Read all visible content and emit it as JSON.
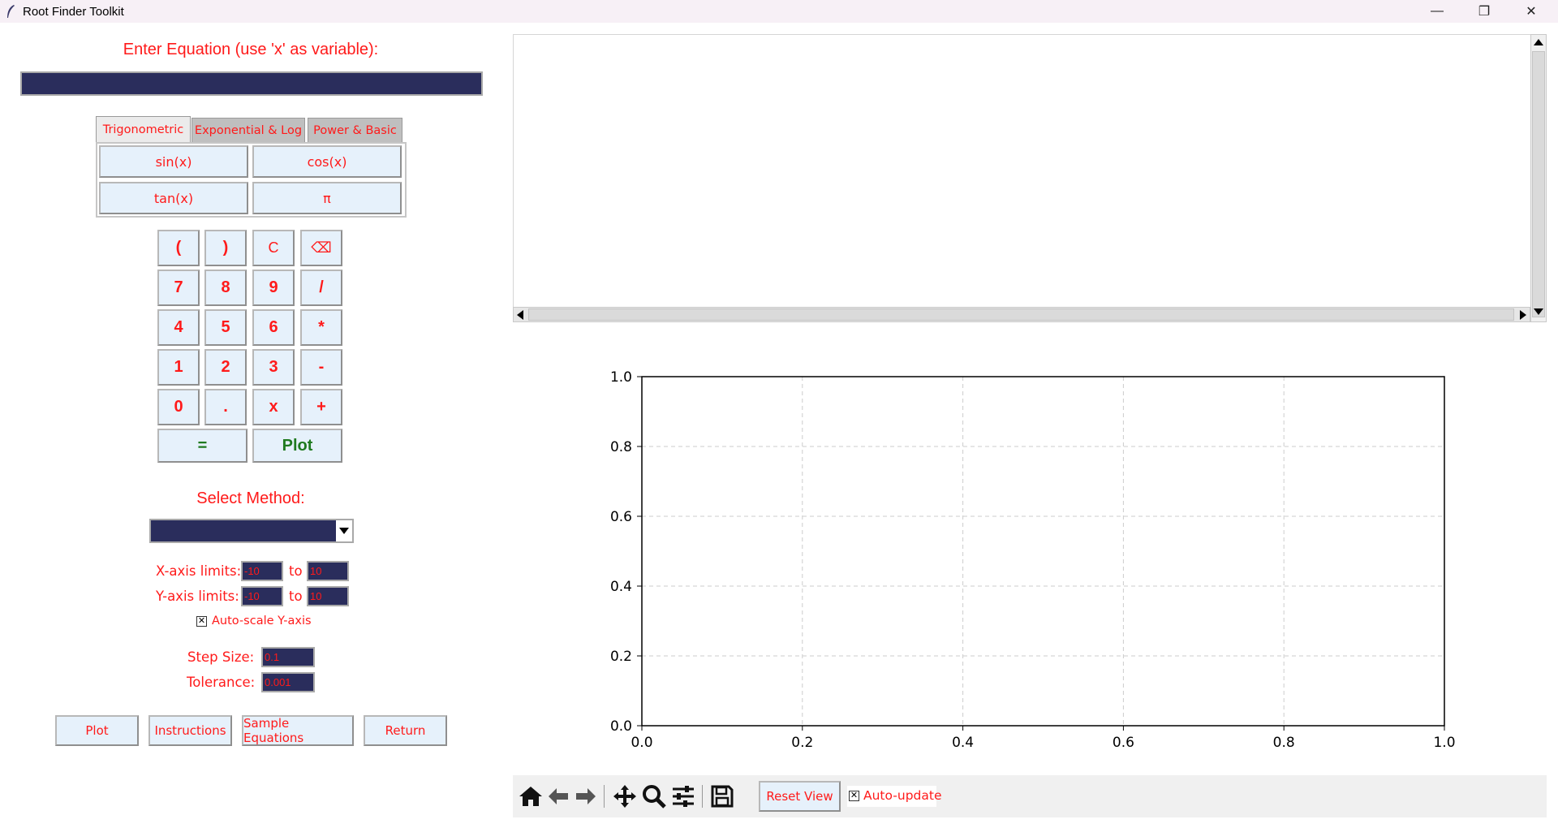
{
  "window": {
    "title": "Root Finder Toolkit",
    "controls": {
      "minimize": "—",
      "restore": "❐",
      "close": "✕"
    }
  },
  "equation": {
    "label": "Enter Equation (use 'x' as variable):",
    "value": ""
  },
  "tabs": [
    {
      "label": "Trigonometric",
      "active": true
    },
    {
      "label": "Exponential & Log",
      "active": false
    },
    {
      "label": "Power & Basic",
      "active": false
    }
  ],
  "functions": [
    "sin(x)",
    "cos(x)",
    "tan(x)",
    "π"
  ],
  "keypad": {
    "rows": [
      [
        "(",
        ")",
        "C",
        "⌫"
      ],
      [
        "7",
        "8",
        "9",
        "/"
      ],
      [
        "4",
        "5",
        "6",
        "*"
      ],
      [
        "1",
        "2",
        "3",
        "-"
      ],
      [
        "0",
        ".",
        "x",
        "+"
      ]
    ],
    "equals": "=",
    "plot": "Plot"
  },
  "method": {
    "label": "Select Method:",
    "value": ""
  },
  "limits": {
    "x_label": "X-axis limits:",
    "y_label": "Y-axis limits:",
    "to": "to",
    "x_min": "-10",
    "x_max": "10",
    "y_min": "-10",
    "y_max": "10"
  },
  "autoscale": {
    "label": "Auto-scale Y-axis",
    "checked": true,
    "mark": "✕"
  },
  "params": {
    "step_label": "Step Size:",
    "step_value": "0.1",
    "tol_label": "Tolerance:",
    "tol_value": "0.001"
  },
  "bottom_buttons": [
    "Plot",
    "Instructions",
    "Sample Equations",
    "Return"
  ],
  "plot_toolbar": {
    "icons": [
      "home-icon",
      "back-arrow-icon",
      "forward-arrow-icon",
      "pan-icon",
      "zoom-icon",
      "configure-icon",
      "save-icon"
    ],
    "reset_label": "Reset View",
    "auto_update_label": "Auto-update",
    "auto_update_checked": true,
    "mark": "✕"
  },
  "colors": {
    "accent_text": "#ff1a1a",
    "input_bg": "#2a2d5c",
    "button_bg": "#e6f1fb",
    "plot_green": "#1f7a1f"
  },
  "chart_data": {
    "type": "line",
    "series": [],
    "xlim": [
      0.0,
      1.0
    ],
    "ylim": [
      0.0,
      1.0
    ],
    "xticks": [
      "0.0",
      "0.2",
      "0.4",
      "0.6",
      "0.8",
      "1.0"
    ],
    "yticks": [
      "0.0",
      "0.2",
      "0.4",
      "0.6",
      "0.8",
      "1.0"
    ],
    "grid": true,
    "title": "",
    "xlabel": "",
    "ylabel": ""
  }
}
